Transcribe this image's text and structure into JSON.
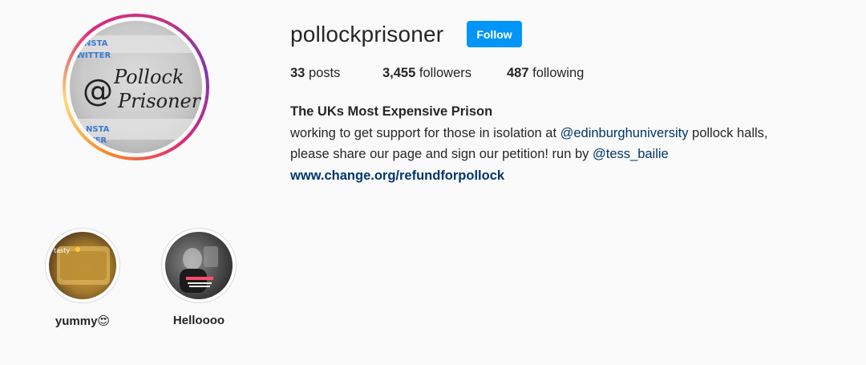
{
  "profile": {
    "username": "pollockprisoner",
    "follow_label": "Follow",
    "avatar_text": {
      "top_small_1": "NSTA",
      "top_small_2": "WITTER",
      "line1": "Pollock",
      "at": "@",
      "line2": "Prisoner",
      "bottom_small_1": "NSTA",
      "bottom_small_2": "ITTER"
    }
  },
  "stats": {
    "posts": {
      "num": "33",
      "label": "posts"
    },
    "followers": {
      "num": "3,455",
      "label": "followers"
    },
    "following": {
      "num": "487",
      "label": "following"
    }
  },
  "bio": {
    "name": "The UKs Most Expensive Prison",
    "line1_pre": "working to get support for those in isolation at ",
    "line1_mention": "@edinburghuniversity",
    "line1_post": " pollock halls,",
    "line2_pre": "please share our page and sign our petition! run by ",
    "line2_mention": "@tess_bailie",
    "link": "www.change.org/refundforpollock"
  },
  "highlights": [
    {
      "label": "yummy😍",
      "caption": "tasty"
    },
    {
      "label": "Helloooo"
    }
  ],
  "colors": {
    "follow_button": "#0095f6",
    "link": "#00376b",
    "background": "#fafafa",
    "text": "#262626"
  }
}
